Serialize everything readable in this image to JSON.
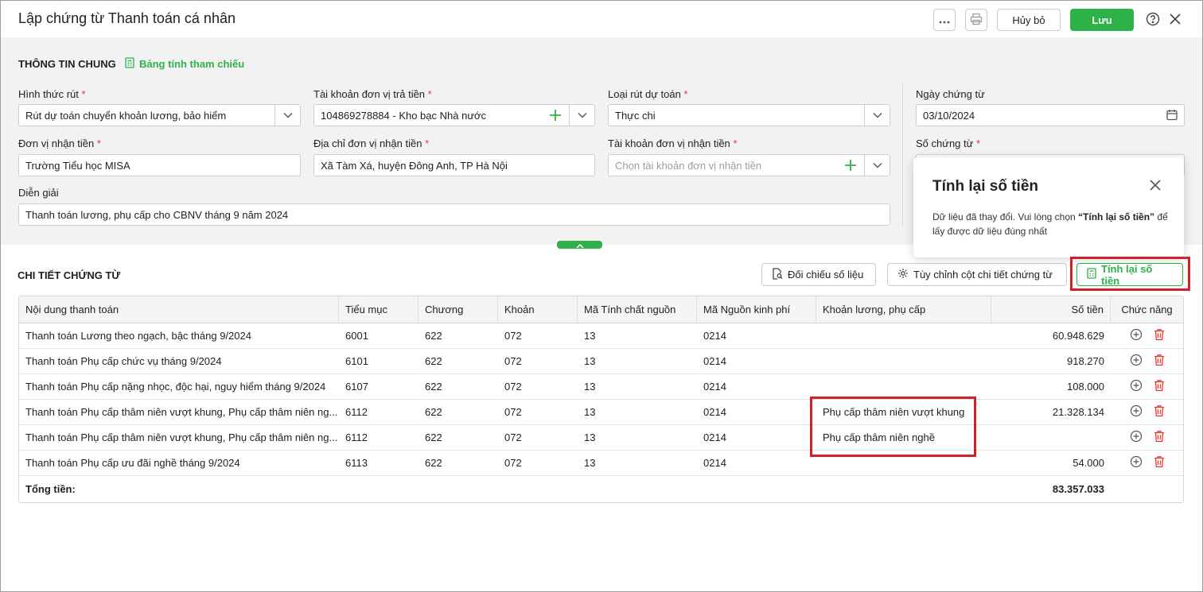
{
  "window": {
    "title": "Lập chứng từ Thanh toán cá nhân"
  },
  "header_actions": {
    "more_icon": "ellipsis-icon",
    "print_icon": "printer-icon",
    "cancel_label": "Hủy bỏ",
    "save_label": "Lưu",
    "help_icon": "question-circle-icon",
    "close_icon": "close-icon"
  },
  "general": {
    "section_title": "THÔNG TIN CHUNG",
    "reference_link": "Bảng tính tham chiếu",
    "fields": {
      "withdraw_type": {
        "label": "Hình thức rút",
        "required_mark": "*",
        "value": "Rút dự toán chuyển khoản lương, bảo hiểm"
      },
      "payer_account": {
        "label": "Tài khoản đơn vị trả tiền",
        "required_mark": "*",
        "value": "104869278884 - Kho bạc Nhà nước"
      },
      "estimate_type": {
        "label": "Loại rút dự toán",
        "required_mark": "*",
        "value": "Thực chi"
      },
      "voucher_date": {
        "label": "Ngày chứng từ",
        "value": "03/10/2024"
      },
      "recipient_unit": {
        "label": "Đơn vị nhận tiền",
        "required_mark": "*",
        "value": "Trường Tiểu học MISA"
      },
      "recipient_address": {
        "label": "Địa chỉ đơn vị nhận tiền",
        "required_mark": "*",
        "value": "Xã Tàm Xá, huyện Đông Anh, TP Hà Nội"
      },
      "recipient_account": {
        "label": "Tài khoản đơn vị nhận tiền",
        "required_mark": "*",
        "placeholder": "Chọn tài khoản đơn vị nhận tiền"
      },
      "voucher_number": {
        "label": "Số chứng từ",
        "required_mark": "*"
      },
      "description": {
        "label": "Diễn giải",
        "value": "Thanh toán lương, phụ cấp cho CBNV tháng 9 năm 2024"
      }
    }
  },
  "popover": {
    "title": "Tính lại số tiền",
    "text_before": "Dữ liệu đã thay đổi. Vui lòng chọn ",
    "text_bold": "“Tính lại số tiền”",
    "text_after": " để lấy được dữ liệu đúng nhất"
  },
  "details": {
    "section_title": "CHI TIẾT CHỨNG TỪ",
    "compare_button": "Đối chiếu số liệu",
    "customize_button": "Tùy chỉnh cột chi tiết chứng từ",
    "recalc_button": "Tính lại số tiền",
    "columns": [
      "Nội dung thanh toán",
      "Tiểu mục",
      "Chương",
      "Khoản",
      "Mã Tính chất nguồn",
      "Mã Nguồn kinh phí",
      "Khoản lương, phụ cấp",
      "Số tiền",
      "Chức năng"
    ],
    "rows": [
      {
        "content": "Thanh toán Lương theo ngạch, bậc tháng 9/2024",
        "tieu_muc": "6001",
        "chuong": "622",
        "khoan": "072",
        "tinh_chat": "13",
        "nguon": "0214",
        "phu_cap": "",
        "so_tien": "60.948.629"
      },
      {
        "content": "Thanh toán Phụ cấp chức vụ tháng 9/2024",
        "tieu_muc": "6101",
        "chuong": "622",
        "khoan": "072",
        "tinh_chat": "13",
        "nguon": "0214",
        "phu_cap": "",
        "so_tien": "918.270"
      },
      {
        "content": "Thanh toán Phụ cấp nặng nhọc, độc hại, nguy hiểm tháng 9/2024",
        "tieu_muc": "6107",
        "chuong": "622",
        "khoan": "072",
        "tinh_chat": "13",
        "nguon": "0214",
        "phu_cap": "",
        "so_tien": "108.000"
      },
      {
        "content": "Thanh toán Phụ cấp thâm niên vượt khung, Phụ cấp thâm niên ng...",
        "tieu_muc": "6112",
        "chuong": "622",
        "khoan": "072",
        "tinh_chat": "13",
        "nguon": "0214",
        "phu_cap": "Phụ cấp thâm niên vượt khung",
        "so_tien": "21.328.134"
      },
      {
        "content": "Thanh toán Phụ cấp thâm niên vượt khung, Phụ cấp thâm niên ng...",
        "tieu_muc": "6112",
        "chuong": "622",
        "khoan": "072",
        "tinh_chat": "13",
        "nguon": "0214",
        "phu_cap": "Phụ cấp thâm niên nghề",
        "so_tien": ""
      },
      {
        "content": "Thanh toán Phụ cấp ưu đãi nghề tháng 9/2024",
        "tieu_muc": "6113",
        "chuong": "622",
        "khoan": "072",
        "tinh_chat": "13",
        "nguon": "0214",
        "phu_cap": "",
        "so_tien": "54.000"
      }
    ],
    "total_label": "Tổng tiền:",
    "total_value": "83.357.033"
  },
  "colors": {
    "accent": "#2db24a",
    "highlight": "#d32027",
    "delete": "#e53935"
  }
}
